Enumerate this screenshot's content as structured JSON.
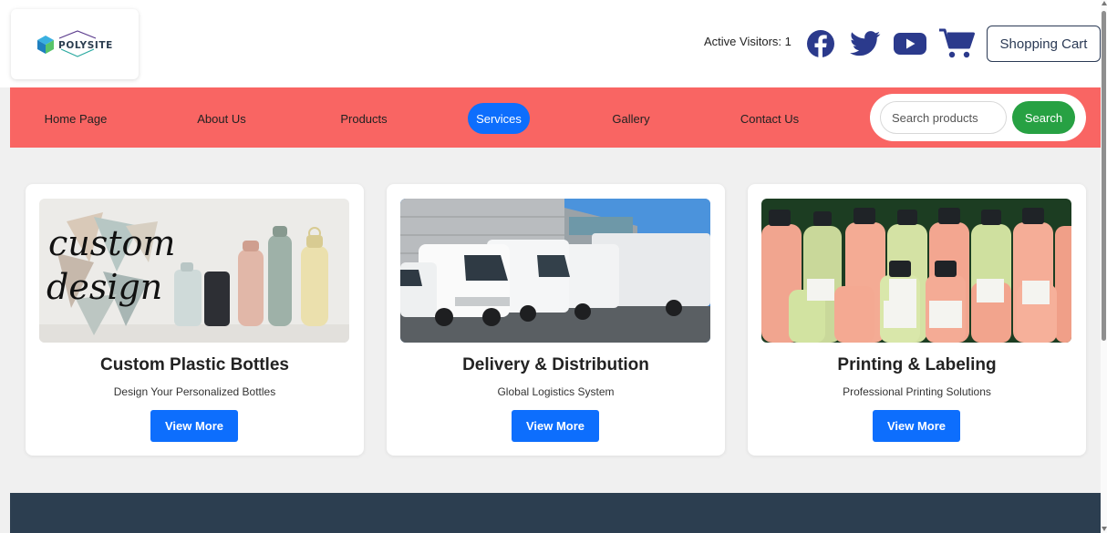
{
  "logo": {
    "text": "POLYSITE"
  },
  "header": {
    "active_visitors": "Active Visitors: 1",
    "cart_button": "Shopping Cart"
  },
  "social_icons": [
    "facebook-icon",
    "twitter-icon",
    "youtube-icon",
    "shopping-cart-icon"
  ],
  "nav": {
    "items": [
      {
        "label": "Home Page"
      },
      {
        "label": "About Us"
      },
      {
        "label": "Products"
      },
      {
        "label": "Services",
        "active": true
      },
      {
        "label": "Gallery"
      },
      {
        "label": "Contact Us"
      }
    ],
    "search": {
      "placeholder": "Search products",
      "value": "",
      "button_label": "Search"
    }
  },
  "cards": [
    {
      "title": "Custom Plastic Bottles",
      "subtitle": "Design Your Personalized Bottles",
      "button": "View More",
      "image_text": [
        "custom",
        "design"
      ]
    },
    {
      "title": "Delivery & Distribution",
      "subtitle": "Global Logistics System",
      "button": "View More"
    },
    {
      "title": "Printing & Labeling",
      "subtitle": "Professional Printing Solutions",
      "button": "View More"
    }
  ],
  "colors": {
    "nav_bg": "#f96563",
    "active_nav": "#0d6efd",
    "primary_button": "#0d6efd",
    "search_button": "#27a143",
    "footer_bg": "#2c3e50",
    "social_icon": "#2b3a8c"
  }
}
